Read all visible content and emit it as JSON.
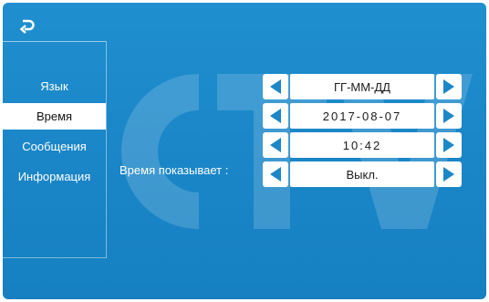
{
  "icons": {
    "back": "return-arrow-icon",
    "left_arrow": "triangle-left-icon",
    "right_arrow": "triangle-right-icon"
  },
  "watermark_text": "CTV",
  "sidebar": {
    "items": [
      {
        "label": "Язык",
        "active": false
      },
      {
        "label": "Время",
        "active": true
      },
      {
        "label": "Сообщения",
        "active": false
      },
      {
        "label": "Информация",
        "active": false
      }
    ]
  },
  "settings": {
    "date_format": "ГГ-ММ-ДД",
    "date": "2017-08-07",
    "time": "10:42",
    "time_display_label": "Время показывает :",
    "time_display_value": "Выкл."
  },
  "colors": {
    "background": "#1b87c8",
    "active_item_bg": "#ffffff",
    "arrow": "#1b87c8"
  }
}
